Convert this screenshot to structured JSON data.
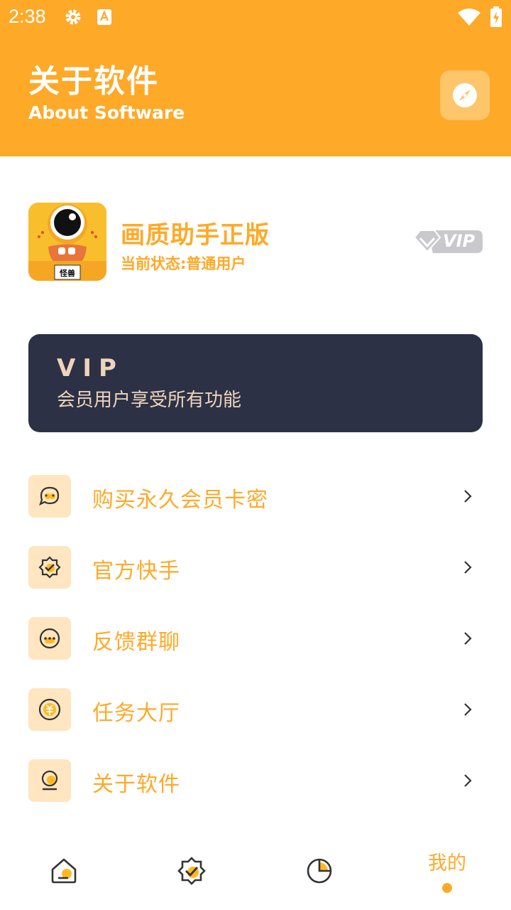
{
  "status_bar": {
    "time": "2:38"
  },
  "header": {
    "title_cn": "关于软件",
    "title_en": "About Software",
    "compass_icon": "compass-icon"
  },
  "app": {
    "name": "画质助手正版",
    "status": "当前状态:普通用户",
    "icon_caption": "怪兽",
    "badge": "VIP"
  },
  "vip_card": {
    "title": "VIP",
    "subtitle": "会员用户享受所有功能"
  },
  "menu": [
    {
      "label": "购买永久会员卡密",
      "icon": "chat-icon"
    },
    {
      "label": "官方快手",
      "icon": "verified-badge-icon"
    },
    {
      "label": "反馈群聊",
      "icon": "message-dots-icon"
    },
    {
      "label": "任务大厅",
      "icon": "coin-icon"
    },
    {
      "label": "关于软件",
      "icon": "user-icon"
    }
  ],
  "bottom_nav": {
    "items": [
      {
        "icon": "home-icon"
      },
      {
        "icon": "verified-badge-icon"
      },
      {
        "icon": "pie-chart-icon"
      },
      {
        "label": "我的",
        "active": true
      }
    ]
  },
  "colors": {
    "accent": "#FFA928",
    "icon_bg": "#FFE5C0",
    "card_bg": "#2C3145",
    "card_text": "#EED4BC"
  }
}
